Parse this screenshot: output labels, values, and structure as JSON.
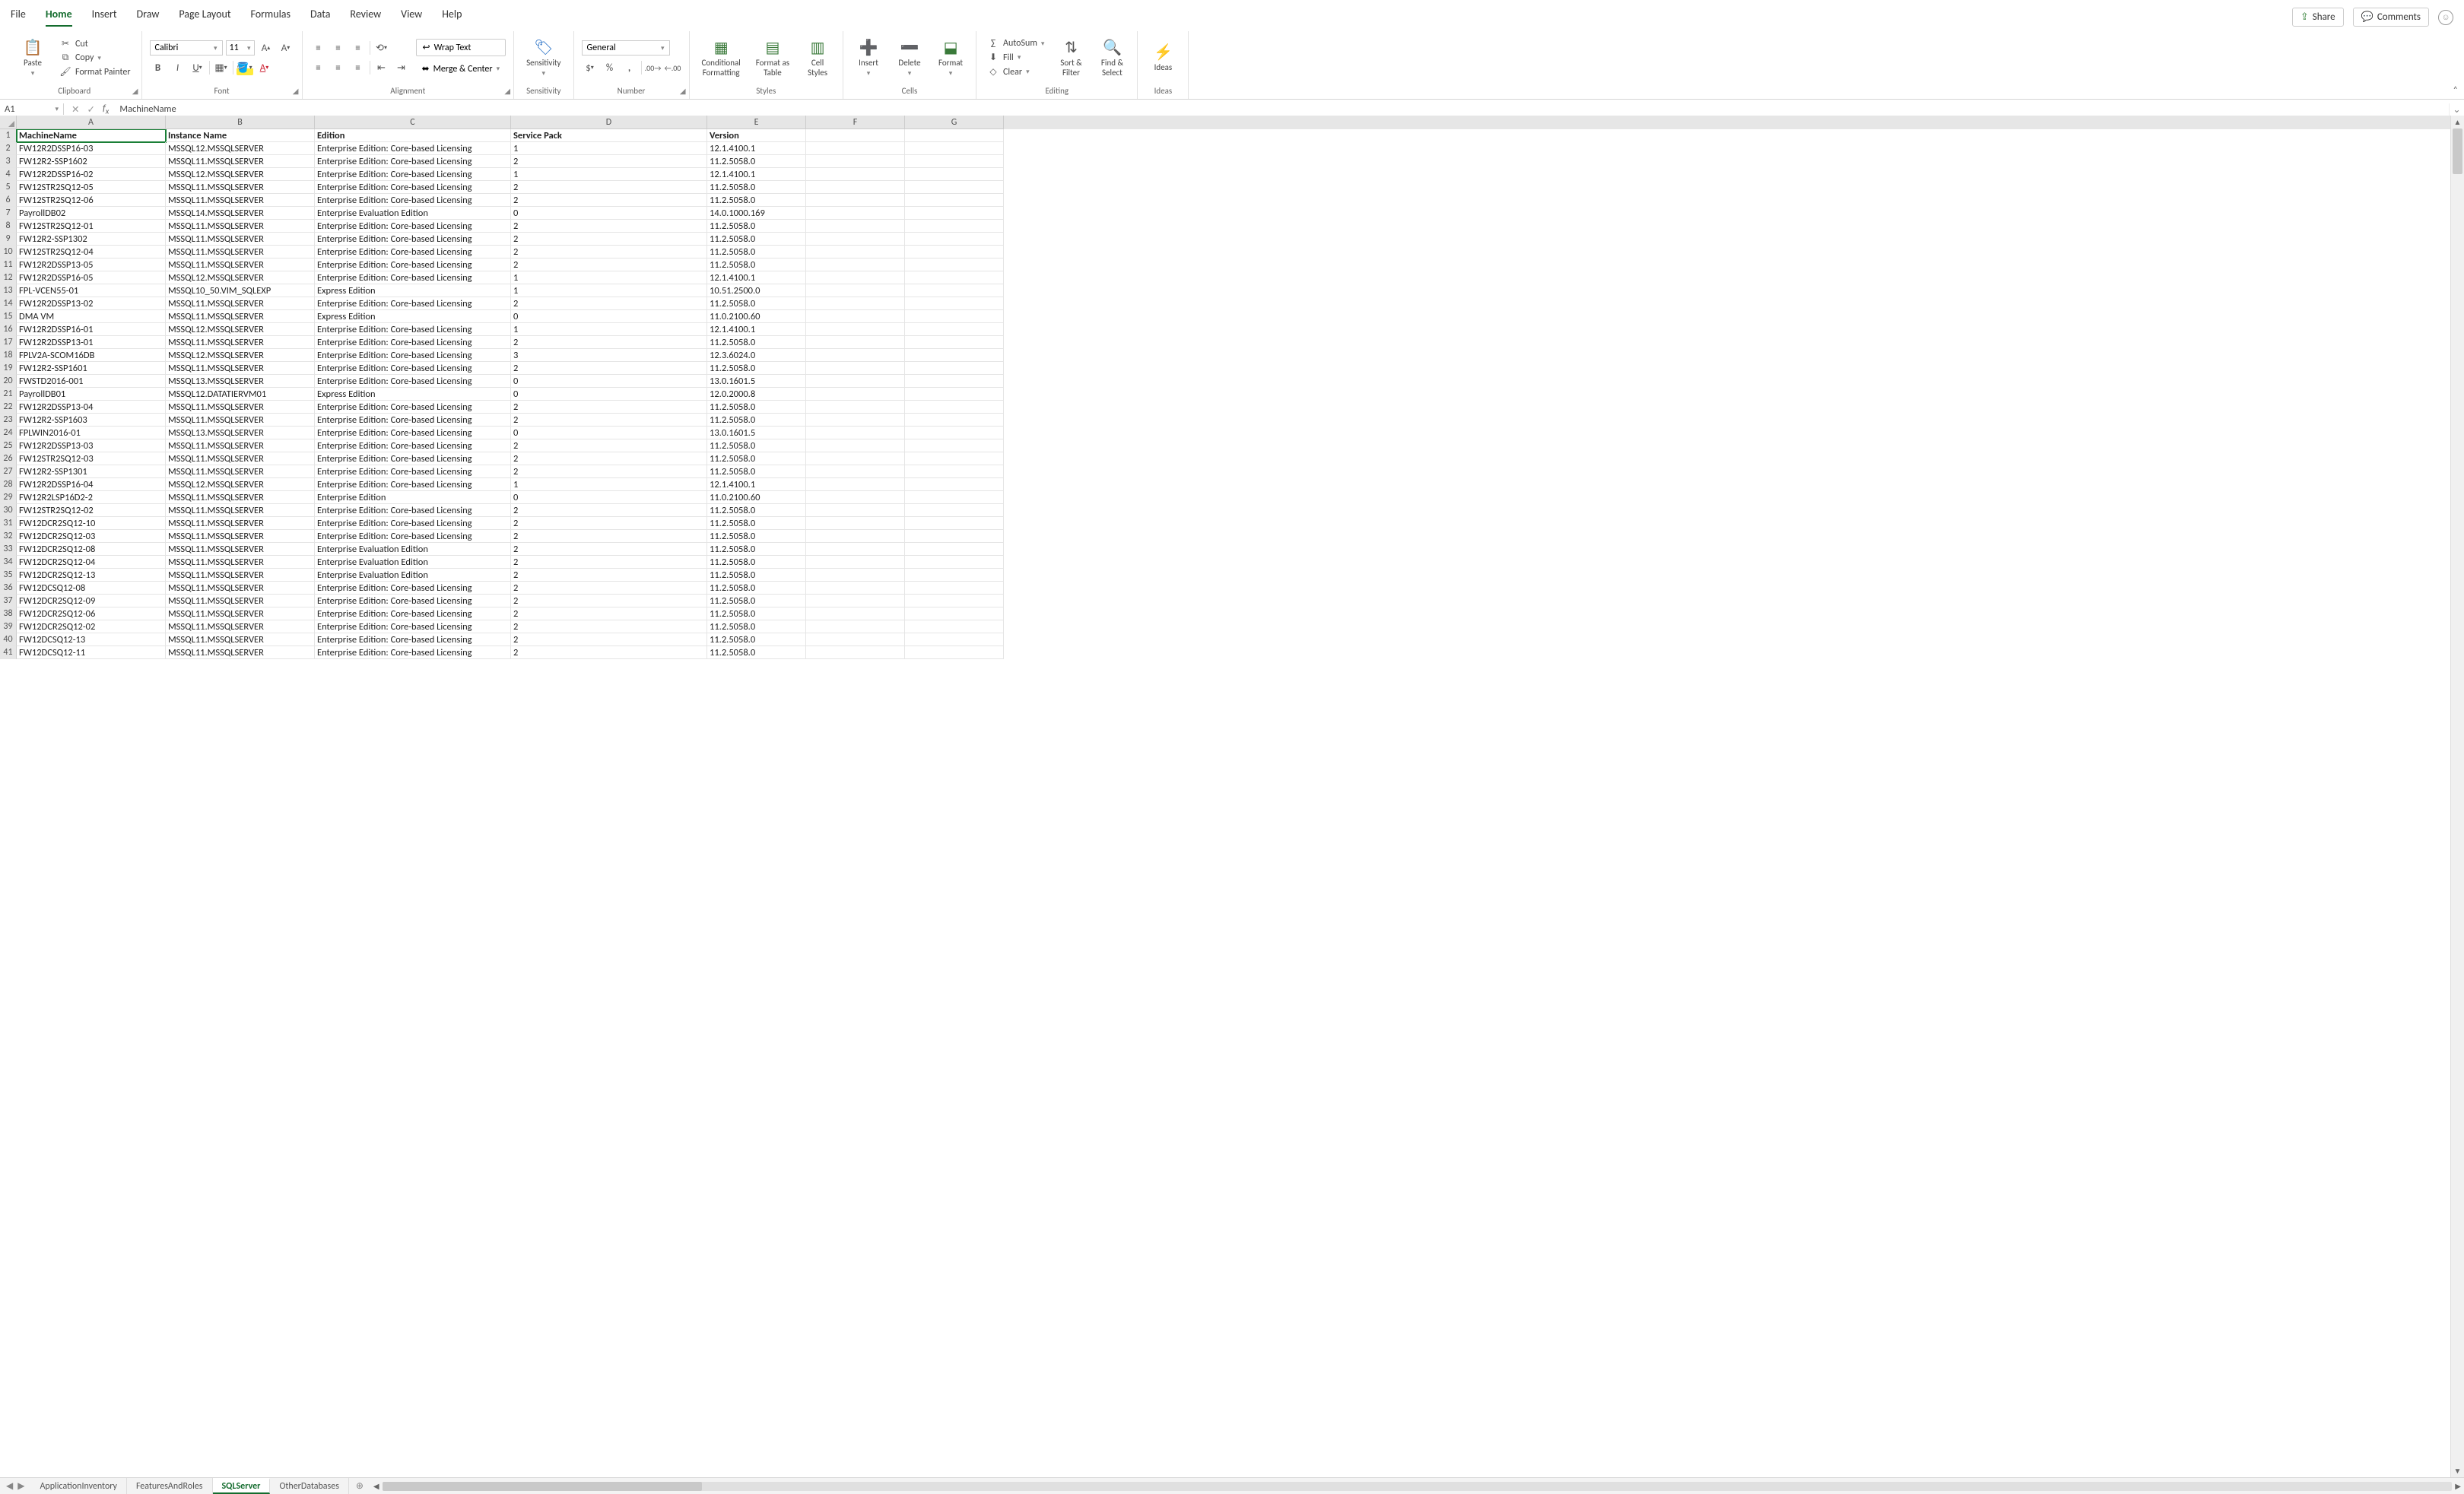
{
  "title": {
    "share": "Share",
    "comments": "Comments"
  },
  "menu": {
    "file": "File",
    "home": "Home",
    "insert": "Insert",
    "draw": "Draw",
    "pageLayout": "Page Layout",
    "formulas": "Formulas",
    "data": "Data",
    "review": "Review",
    "view": "View",
    "help": "Help"
  },
  "ribbon": {
    "clipboard": {
      "paste": "Paste",
      "cut": "Cut",
      "copy": "Copy",
      "formatPainter": "Format Painter",
      "group": "Clipboard"
    },
    "font": {
      "name": "Calibri",
      "size": "11",
      "group": "Font"
    },
    "alignment": {
      "wrap": "Wrap Text",
      "merge": "Merge & Center",
      "group": "Alignment"
    },
    "sensitivity": {
      "btn": "Sensitivity",
      "group": "Sensitivity"
    },
    "number": {
      "fmt": "General",
      "group": "Number"
    },
    "styles": {
      "cond": "Conditional\nFormatting",
      "fat": "Format as\nTable",
      "cell": "Cell\nStyles",
      "group": "Styles"
    },
    "cells": {
      "insert": "Insert",
      "delete": "Delete",
      "format": "Format",
      "group": "Cells"
    },
    "editing": {
      "autosum": "AutoSum",
      "fill": "Fill",
      "clear": "Clear",
      "sort": "Sort &\nFilter",
      "find": "Find &\nSelect",
      "group": "Editing"
    },
    "ideas": {
      "btn": "Ideas",
      "group": "Ideas"
    }
  },
  "formulaBar": {
    "nameBox": "A1",
    "formula": "MachineName"
  },
  "columns": [
    "A",
    "B",
    "C",
    "D",
    "E",
    "F",
    "G"
  ],
  "headers": {
    "A": "MachineName",
    "B": "Instance Name",
    "C": "Edition",
    "D": "Service Pack",
    "E": "Version"
  },
  "rows": [
    {
      "A": "FW12R2DSSP16-03",
      "B": "MSSQL12.MSSQLSERVER",
      "C": "Enterprise Edition: Core-based Licensing",
      "D": "1",
      "E": "12.1.4100.1"
    },
    {
      "A": "FW12R2-SSP1602",
      "B": "MSSQL11.MSSQLSERVER",
      "C": "Enterprise Edition: Core-based Licensing",
      "D": "2",
      "E": "11.2.5058.0"
    },
    {
      "A": "FW12R2DSSP16-02",
      "B": "MSSQL12.MSSQLSERVER",
      "C": "Enterprise Edition: Core-based Licensing",
      "D": "1",
      "E": "12.1.4100.1"
    },
    {
      "A": "FW12STR2SQ12-05",
      "B": "MSSQL11.MSSQLSERVER",
      "C": "Enterprise Edition: Core-based Licensing",
      "D": "2",
      "E": "11.2.5058.0"
    },
    {
      "A": "FW12STR2SQ12-06",
      "B": "MSSQL11.MSSQLSERVER",
      "C": "Enterprise Edition: Core-based Licensing",
      "D": "2",
      "E": "11.2.5058.0"
    },
    {
      "A": "PayrollDB02",
      "B": "MSSQL14.MSSQLSERVER",
      "C": "Enterprise Evaluation Edition",
      "D": "0",
      "E": "14.0.1000.169"
    },
    {
      "A": "FW12STR2SQ12-01",
      "B": "MSSQL11.MSSQLSERVER",
      "C": "Enterprise Edition: Core-based Licensing",
      "D": "2",
      "E": "11.2.5058.0"
    },
    {
      "A": "FW12R2-SSP1302",
      "B": "MSSQL11.MSSQLSERVER",
      "C": "Enterprise Edition: Core-based Licensing",
      "D": "2",
      "E": "11.2.5058.0"
    },
    {
      "A": "FW12STR2SQ12-04",
      "B": "MSSQL11.MSSQLSERVER",
      "C": "Enterprise Edition: Core-based Licensing",
      "D": "2",
      "E": "11.2.5058.0"
    },
    {
      "A": "FW12R2DSSP13-05",
      "B": "MSSQL11.MSSQLSERVER",
      "C": "Enterprise Edition: Core-based Licensing",
      "D": "2",
      "E": "11.2.5058.0"
    },
    {
      "A": "FW12R2DSSP16-05",
      "B": "MSSQL12.MSSQLSERVER",
      "C": "Enterprise Edition: Core-based Licensing",
      "D": "1",
      "E": "12.1.4100.1"
    },
    {
      "A": "FPL-VCEN55-01",
      "B": "MSSQL10_50.VIM_SQLEXP",
      "C": "Express Edition",
      "D": "1",
      "E": "10.51.2500.0"
    },
    {
      "A": "FW12R2DSSP13-02",
      "B": "MSSQL11.MSSQLSERVER",
      "C": "Enterprise Edition: Core-based Licensing",
      "D": "2",
      "E": "11.2.5058.0"
    },
    {
      "A": "DMA VM",
      "B": "MSSQL11.MSSQLSERVER",
      "C": "Express Edition",
      "D": "0",
      "E": "11.0.2100.60"
    },
    {
      "A": "FW12R2DSSP16-01",
      "B": "MSSQL12.MSSQLSERVER",
      "C": "Enterprise Edition: Core-based Licensing",
      "D": "1",
      "E": "12.1.4100.1"
    },
    {
      "A": "FW12R2DSSP13-01",
      "B": "MSSQL11.MSSQLSERVER",
      "C": "Enterprise Edition: Core-based Licensing",
      "D": "2",
      "E": "11.2.5058.0"
    },
    {
      "A": "FPLV2A-SCOM16DB",
      "B": "MSSQL12.MSSQLSERVER",
      "C": "Enterprise Edition: Core-based Licensing",
      "D": "3",
      "E": "12.3.6024.0"
    },
    {
      "A": "FW12R2-SSP1601",
      "B": "MSSQL11.MSSQLSERVER",
      "C": "Enterprise Edition: Core-based Licensing",
      "D": "2",
      "E": "11.2.5058.0"
    },
    {
      "A": "FWSTD2016-001",
      "B": "MSSQL13.MSSQLSERVER",
      "C": "Enterprise Edition: Core-based Licensing",
      "D": "0",
      "E": "13.0.1601.5"
    },
    {
      "A": "PayrollDB01",
      "B": "MSSQL12.DATATIERVM01",
      "C": "Express Edition",
      "D": "0",
      "E": "12.0.2000.8"
    },
    {
      "A": "FW12R2DSSP13-04",
      "B": "MSSQL11.MSSQLSERVER",
      "C": "Enterprise Edition: Core-based Licensing",
      "D": "2",
      "E": "11.2.5058.0"
    },
    {
      "A": "FW12R2-SSP1603",
      "B": "MSSQL11.MSSQLSERVER",
      "C": "Enterprise Edition: Core-based Licensing",
      "D": "2",
      "E": "11.2.5058.0"
    },
    {
      "A": "FPLWIN2016-01",
      "B": "MSSQL13.MSSQLSERVER",
      "C": "Enterprise Edition: Core-based Licensing",
      "D": "0",
      "E": "13.0.1601.5"
    },
    {
      "A": "FW12R2DSSP13-03",
      "B": "MSSQL11.MSSQLSERVER",
      "C": "Enterprise Edition: Core-based Licensing",
      "D": "2",
      "E": "11.2.5058.0"
    },
    {
      "A": "FW12STR2SQ12-03",
      "B": "MSSQL11.MSSQLSERVER",
      "C": "Enterprise Edition: Core-based Licensing",
      "D": "2",
      "E": "11.2.5058.0"
    },
    {
      "A": "FW12R2-SSP1301",
      "B": "MSSQL11.MSSQLSERVER",
      "C": "Enterprise Edition: Core-based Licensing",
      "D": "2",
      "E": "11.2.5058.0"
    },
    {
      "A": "FW12R2DSSP16-04",
      "B": "MSSQL12.MSSQLSERVER",
      "C": "Enterprise Edition: Core-based Licensing",
      "D": "1",
      "E": "12.1.4100.1"
    },
    {
      "A": "FW12R2LSP16D2-2",
      "B": "MSSQL11.MSSQLSERVER",
      "C": "Enterprise Edition",
      "D": "0",
      "E": "11.0.2100.60"
    },
    {
      "A": "FW12STR2SQ12-02",
      "B": "MSSQL11.MSSQLSERVER",
      "C": "Enterprise Edition: Core-based Licensing",
      "D": "2",
      "E": "11.2.5058.0"
    },
    {
      "A": "FW12DCR2SQ12-10",
      "B": "MSSQL11.MSSQLSERVER",
      "C": "Enterprise Edition: Core-based Licensing",
      "D": "2",
      "E": "11.2.5058.0"
    },
    {
      "A": "FW12DCR2SQ12-03",
      "B": "MSSQL11.MSSQLSERVER",
      "C": "Enterprise Edition: Core-based Licensing",
      "D": "2",
      "E": "11.2.5058.0"
    },
    {
      "A": "FW12DCR2SQ12-08",
      "B": "MSSQL11.MSSQLSERVER",
      "C": "Enterprise Evaluation Edition",
      "D": "2",
      "E": "11.2.5058.0"
    },
    {
      "A": "FW12DCR2SQ12-04",
      "B": "MSSQL11.MSSQLSERVER",
      "C": "Enterprise Evaluation Edition",
      "D": "2",
      "E": "11.2.5058.0"
    },
    {
      "A": "FW12DCR2SQ12-13",
      "B": "MSSQL11.MSSQLSERVER",
      "C": "Enterprise Evaluation Edition",
      "D": "2",
      "E": "11.2.5058.0"
    },
    {
      "A": "FW12DCSQ12-08",
      "B": "MSSQL11.MSSQLSERVER",
      "C": "Enterprise Edition: Core-based Licensing",
      "D": "2",
      "E": "11.2.5058.0"
    },
    {
      "A": "FW12DCR2SQ12-09",
      "B": "MSSQL11.MSSQLSERVER",
      "C": "Enterprise Edition: Core-based Licensing",
      "D": "2",
      "E": "11.2.5058.0"
    },
    {
      "A": "FW12DCR2SQ12-06",
      "B": "MSSQL11.MSSQLSERVER",
      "C": "Enterprise Edition: Core-based Licensing",
      "D": "2",
      "E": "11.2.5058.0"
    },
    {
      "A": "FW12DCR2SQ12-02",
      "B": "MSSQL11.MSSQLSERVER",
      "C": "Enterprise Edition: Core-based Licensing",
      "D": "2",
      "E": "11.2.5058.0"
    },
    {
      "A": "FW12DCSQ12-13",
      "B": "MSSQL11.MSSQLSERVER",
      "C": "Enterprise Edition: Core-based Licensing",
      "D": "2",
      "E": "11.2.5058.0"
    },
    {
      "A": "FW12DCSQ12-11",
      "B": "MSSQL11.MSSQLSERVER",
      "C": "Enterprise Edition: Core-based Licensing",
      "D": "2",
      "E": "11.2.5058.0"
    }
  ],
  "sheetTabs": {
    "t1": "ApplicationInventory",
    "t2": "FeaturesAndRoles",
    "t3": "SQLServer",
    "t4": "OtherDatabases"
  }
}
